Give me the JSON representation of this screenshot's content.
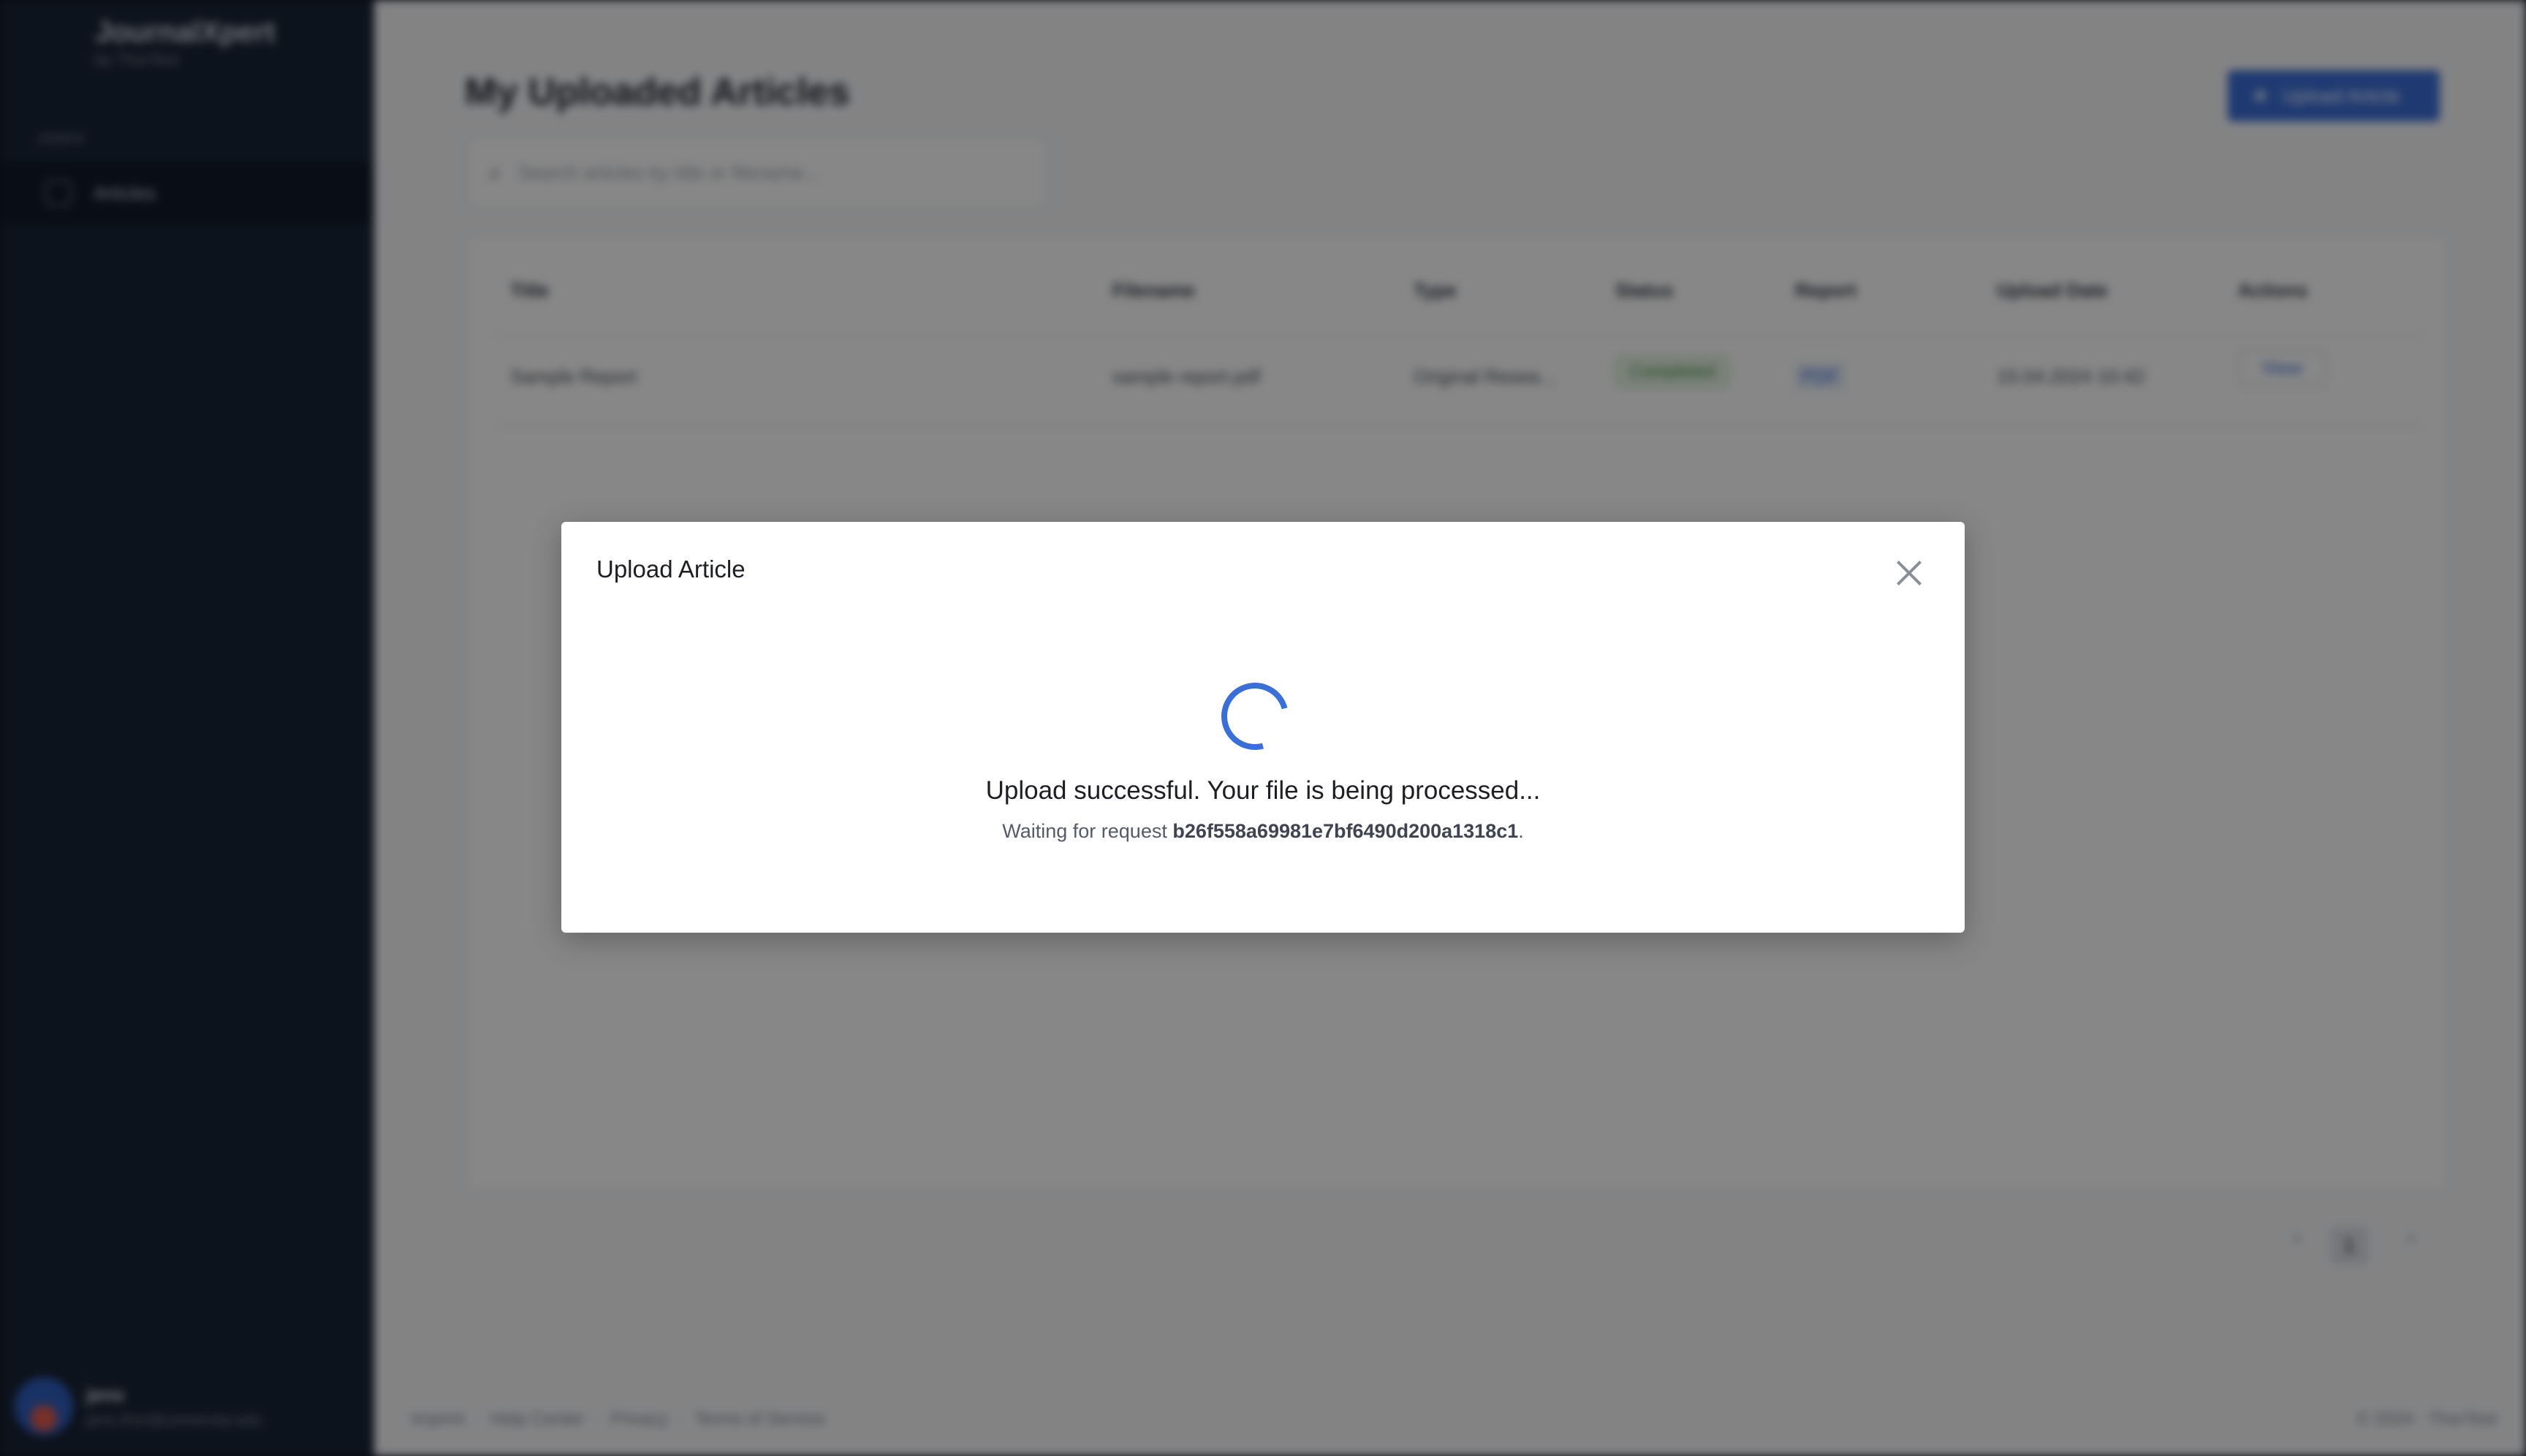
{
  "sidebar": {
    "brand_name": "JournalXpert",
    "brand_sub": "by ThorTest",
    "section_label": "ADMIN",
    "nav_items": [
      {
        "label": "Articles",
        "icon": "document-icon"
      }
    ],
    "user": {
      "name": "jens",
      "email": "jens.thor@university.edu"
    }
  },
  "main": {
    "page_title": "My Uploaded Articles",
    "upload_button": "Upload Article",
    "search_placeholder": "Search articles by title or filename...",
    "table": {
      "headers": [
        "Title",
        "Filename",
        "Type",
        "Status",
        "Report",
        "Upload Date",
        "Actions"
      ],
      "rows": [
        {
          "title": "Sample Report",
          "filename": "sample report.pdf",
          "type": "Original Resea...",
          "status": "Completed",
          "report": "PDF",
          "upload_date": "15.04.2024 10:42",
          "action": "View"
        }
      ]
    },
    "pagination": {
      "prev": "‹",
      "current": "1",
      "next": "›"
    },
    "footer": {
      "links": [
        "Imprint",
        "Help Center",
        "Privacy",
        "Terms of Service"
      ],
      "separator": "·",
      "copyright": "© 2024 · ThorTest"
    }
  },
  "modal": {
    "title": "Upload Article",
    "message": "Upload successful. Your file is being processed...",
    "sub_prefix": "Waiting for request ",
    "request_id": "b26f558a69981e7bf6490d200a1318c1",
    "sub_suffix": "."
  },
  "colors": {
    "accent": "#3b6fd8",
    "sidebar": "#1a2436",
    "overlay": "rgba(0,0,0,0.47)"
  }
}
